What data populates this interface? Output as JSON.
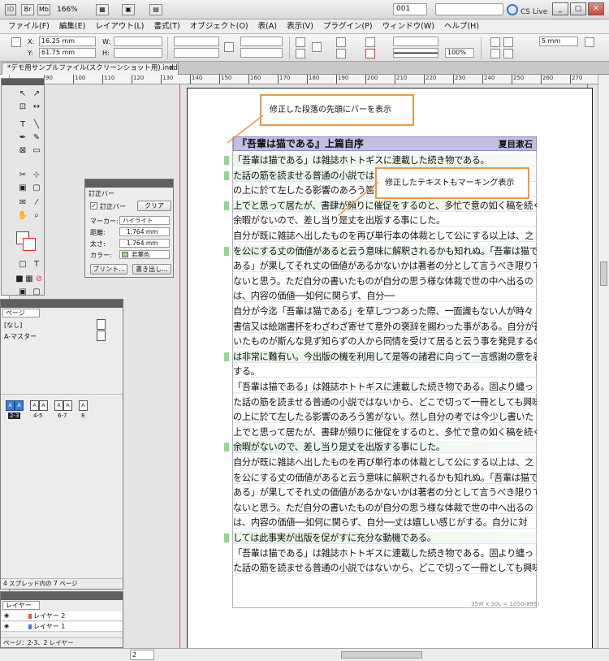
{
  "app": {
    "logo": "ID",
    "zoom": "166%",
    "page_field": "001",
    "cs_live": "CS Live",
    "win_buttons": [
      "_",
      "□",
      "✕"
    ]
  },
  "menu": [
    "ファイル(F)",
    "編集(E)",
    "レイアウト(L)",
    "書式(T)",
    "オブジェクト(O)",
    "表(A)",
    "表示(V)",
    "プラグイン(P)",
    "ウィンドウ(W)",
    "ヘルプ(H)"
  ],
  "control": {
    "x_label": "X:",
    "x_value": "16.25 mm",
    "y_label": "Y:",
    "y_value": "61.75 mm",
    "w_label": "W:",
    "h_label": "H:",
    "stroke_weight": "5 mm",
    "opacity": "100%"
  },
  "doc_tab": {
    "title": "*デモ用サンプルファイル(スクリーンショット用).indd @ 166%",
    "close": "×"
  },
  "ruler_numbers": [
    "90",
    "100",
    "110",
    "120",
    "130",
    "140",
    "150",
    "160",
    "170",
    "180",
    "190",
    "200",
    "210",
    "220",
    "230",
    "240",
    "250",
    "260",
    "270"
  ],
  "callouts": {
    "para_bar": "修正した段落の先頭にバーを表示",
    "text_mark": "修正したテキストもマーキング表示"
  },
  "revision_panel": {
    "title": "訂正バー",
    "checkbox_label": "訂正バー",
    "clear_button": "クリア",
    "marker_label": "マーカー:",
    "marker_value": "ハイライト",
    "distance_label": "距離:",
    "distance_value": "1.764 mm",
    "thickness_label": "太さ:",
    "thickness_value": "1.764 mm",
    "color_label": "カラー:",
    "color_value": "若葉色",
    "color_hex": "#9fd58a",
    "print_button": "プリント...",
    "export_button": "書き出し..."
  },
  "pages_panel": {
    "tab": "ページ",
    "master_none": "[なし]",
    "master_a": "A-マスター",
    "spreads": [
      "2-3",
      "4-5",
      "6-7",
      "8"
    ],
    "footer": "4 スプレッド内の 7 ページ"
  },
  "layers_panel": {
    "tab": "レイヤー",
    "layers": [
      {
        "name": "レイヤー 2",
        "color": "#e05050"
      },
      {
        "name": "レイヤー 1",
        "color": "#4a70d8"
      }
    ],
    "footer": "ページ：2-3、2 レイヤー"
  },
  "status": {
    "page_field": "2"
  },
  "frame_info": "35W x 30L = 1050(899)",
  "document": {
    "title": "『吾輩は猫である』上篇自序",
    "author": "夏目漱石",
    "lines": [
      {
        "text": "「吾輩は猫である」は雑誌ホトトギスに連載した続き物である。",
        "mark": true
      },
      {
        "text": "た話の筋を読ませる普通の小説ではないから、どこで切っても",
        "mark": true
      },
      {
        "text": "の上に於て左したる影響のあろう筈がない。然し自分の考では",
        "mark": false
      },
      {
        "text": "上でと思って居たが、書肆が頻りに催促をするのと、多忙で意の如く稿を続く",
        "mark": true
      },
      {
        "text": "余暇がないので、差し当り是丈を出版する事にした。",
        "mark": false
      },
      {
        "text": "自分が既に雑誌へ出したものを再び単行本の体裁として公にする以上は、之",
        "mark": false
      },
      {
        "text": "を公にする丈の価値があると云う意味に解釈されるかも知れぬ。「吾輩は猫で",
        "mark": true
      },
      {
        "text": "ある」が果してそれ丈の価値があるかないかは著者の分として言うべき限りで",
        "mark": false
      },
      {
        "text": "ないと思う。ただ自分の書いたものが自分の思う様な体裁で世の中へ出るの",
        "mark": false
      },
      {
        "text": "は、内容の価値──如何に関らず、自分──",
        "mark": false
      },
      {
        "text": "自分が今迄「吾輩は猫である」を草しつつあった際、一面識もない人が時々",
        "mark": false
      },
      {
        "text": "書信又は絵端書抔をわざわざ寄せて意外の褒辞を賜わった事がある。自分が書",
        "mark": false
      },
      {
        "text": "いたものが斯んな見ず知らずの人から同情を受けて居ると云う事を発見するの",
        "mark": false
      },
      {
        "text": "は非常に難有い。今出版の機を利用して是等の諸君に向って一言感謝の意を表",
        "mark": true
      },
      {
        "text": "する。",
        "mark": false
      },
      {
        "text": "「吾輩は猫である」は雑誌ホトトギスに連載した続き物である。固より纏っ",
        "mark": false
      },
      {
        "text": "た話の筋を読ませる普通の小説ではないから、どこで切って一冊としても興味",
        "mark": false
      },
      {
        "text": "の上に於て左したる影響のあろう筈がない。然し自分の考では今少し書いた",
        "mark": false
      },
      {
        "text": "上でと思って居たが、書肆が頻りに催促をするのと、多忙で意の如く稿を続く",
        "mark": false
      },
      {
        "text": "余暇がないので、差し当り是丈を出版する事にした。",
        "mark": true
      },
      {
        "text": "自分が既に雑誌へ出したものを再び単行本の体裁として公にする以上は、之",
        "mark": false
      },
      {
        "text": "を公にする丈の価値があると云う意味に解釈されるかも知れぬ。「吾輩は猫で",
        "mark": false
      },
      {
        "text": "ある」が果してそれ丈の価値があるかないかは著者の分として言うべき限りで",
        "mark": false
      },
      {
        "text": "ないと思う。ただ自分の書いたものが自分の思う様な体裁で世の中へ出るの",
        "mark": false
      },
      {
        "text": "は、内容の価値──如何に関らず、自分──丈は嬉しい感じがする。自分に対",
        "mark": false
      },
      {
        "text": "しては此事実が出版を促がすに充分な動機である。",
        "mark": true
      },
      {
        "text": "「吾輩は猫である」は雑誌ホトトギスに連載した続き物である。固より纏っ",
        "mark": false
      },
      {
        "text": "た話の筋を読ませる普通の小説ではないから、どこで切って一冊としても興味",
        "mark": false
      }
    ]
  },
  "colors": {
    "change_bar": "#8fd88f",
    "heading_fill": "#c3bfe2",
    "callout_border": "#e89a45"
  }
}
